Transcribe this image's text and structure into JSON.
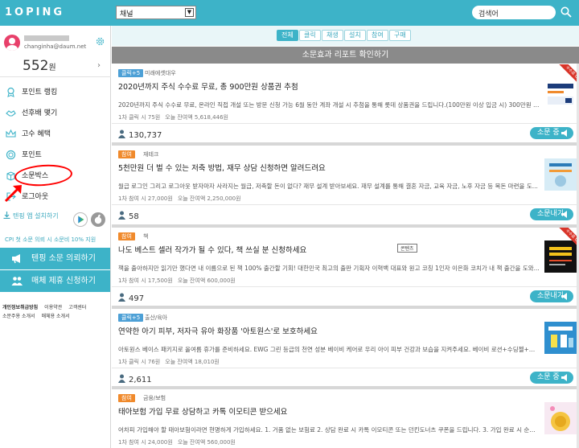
{
  "topbar": {
    "logo": "1OPING",
    "channel_value": "채널",
    "search_placeholder": "검색어",
    "bg_color": "#3db3c8"
  },
  "profile": {
    "email": "changinha@daum.net",
    "points": "552",
    "points_unit": "원"
  },
  "sidebar": {
    "items": [
      {
        "label": "포인트 랭킹",
        "icon": "medal-icon"
      },
      {
        "label": "선후배 맺기",
        "icon": "handshake-icon"
      },
      {
        "label": "고수 혜택",
        "icon": "crown-icon"
      },
      {
        "label": "포인트",
        "icon": "coin-icon"
      },
      {
        "label": "소문박스",
        "icon": "box-icon"
      },
      {
        "label": "로그아웃",
        "icon": "logout-icon"
      }
    ],
    "app_install": "텐핑 앱 설치하기",
    "cpi_text": "CPI 첫 소문 의뢰 시 소문비 10% 지원",
    "btn_request": "텐핑 소문 의뢰하기",
    "btn_media": "매체 제휴 신청하기",
    "footer": [
      "개인정보취급방침",
      "이용약관",
      "고객센터",
      "소문주용 소개서",
      "매체용 소개서"
    ]
  },
  "filters": [
    "전체",
    "클릭",
    "채생",
    "설치",
    "참여",
    "구매"
  ],
  "banner": "소문효과 리포트 확인하기",
  "cards": [
    {
      "tag": "클릭+5",
      "tag_type": "click",
      "category": "미래에셋대우",
      "title": "2020년까지 주식 수수료 무료, 총 900만원 상품권 추첨",
      "desc": "2020년까지 주식 수수료 무료, 온라인 직접 개설 또는 방문 신청 가능 6월 동안 계좌 개설 시 추첨을 통해 롯데 상품권을 드립니다.(100만원 이상 입금 시) 300만원 1...",
      "reward": "1차 클릭 시 75원",
      "budget": "오늘 잔여액 5,618,446원",
      "count": "130,737",
      "action": "소문 중",
      "ribbon": "수수료 UP"
    },
    {
      "tag": "참여",
      "tag_type": "join",
      "category": "재테크",
      "title": "5천만원 더 벌 수 있는 저축 방법, 재무 상담 신청하면 알려드려요",
      "desc": "월급 로그인 그리고 로그아웃 받자마자 사라지는 월급, 저축할 돈이 없다? 재무 설계 받아보세요. 재무 설계를 통해 결혼 자금, 교육 자금, 노후 자금 등 목돈 마련을 도...",
      "reward": "1차 참여 시 27,000원",
      "budget": "오늘 잔여액 2,250,000원",
      "count": "58",
      "action": "소문내기"
    },
    {
      "tag": "참여",
      "tag_type": "join",
      "category": "책",
      "title": "나도 베스트 셀러 작가가 될 수 있다, 책 쓰실 분 신청하세요",
      "badge": "콘텐츠",
      "desc": "책을 출아하지만 읽기만 했다면 내 이름으로 된 책 100% 출간할 기회! 대한민국 최고의 출판 기획자 이혁백 대표와 원고 코칭 1인자 이은화 코치가 내 책 출간을 도와...",
      "reward": "1차 참여 시 17,500원",
      "budget": "오늘 잔여액 600,000원",
      "count": "497",
      "action": "소문내기",
      "ribbon": "수수료 UP"
    },
    {
      "tag": "클릭+5",
      "tag_type": "click",
      "category": "출산/육아",
      "title": "연약한 아기 피부, 저자극 유아 화장품 '아토원스'로 보호하세요",
      "desc": "아토원스 베이스 패키지로 올여름 휴가를 준비하세요. EWG 그린 등급의 천연 성분 베이비 케어로 우리 아이 피부 건강과 보습을 지켜주세요. 베이비 로션+수딩젤+베...",
      "reward": "1차 클릭 시 76원",
      "budget": "오늘 잔여액 18,010원",
      "count": "2,611",
      "action": "소문 중"
    },
    {
      "tag": "참여",
      "tag_type": "join",
      "category": "금융/보험",
      "title": "태아보험 가입 무료 상담하고 카톡 이모티콘 받으세요",
      "desc": "어차피 가입해야 할 태아보험이라면 현명하게 가입하세요. 1. 거품 없는 보험료 2. 상담 완료 시 카톡 이모티콘 또는 던킨도너츠 쿠폰을 드립니다. 3. 가입 완료 시 순금...",
      "reward": "1차 참여 시 24,000원",
      "budget": "오늘 잔여액 560,000원",
      "count": "",
      "action": ""
    }
  ]
}
